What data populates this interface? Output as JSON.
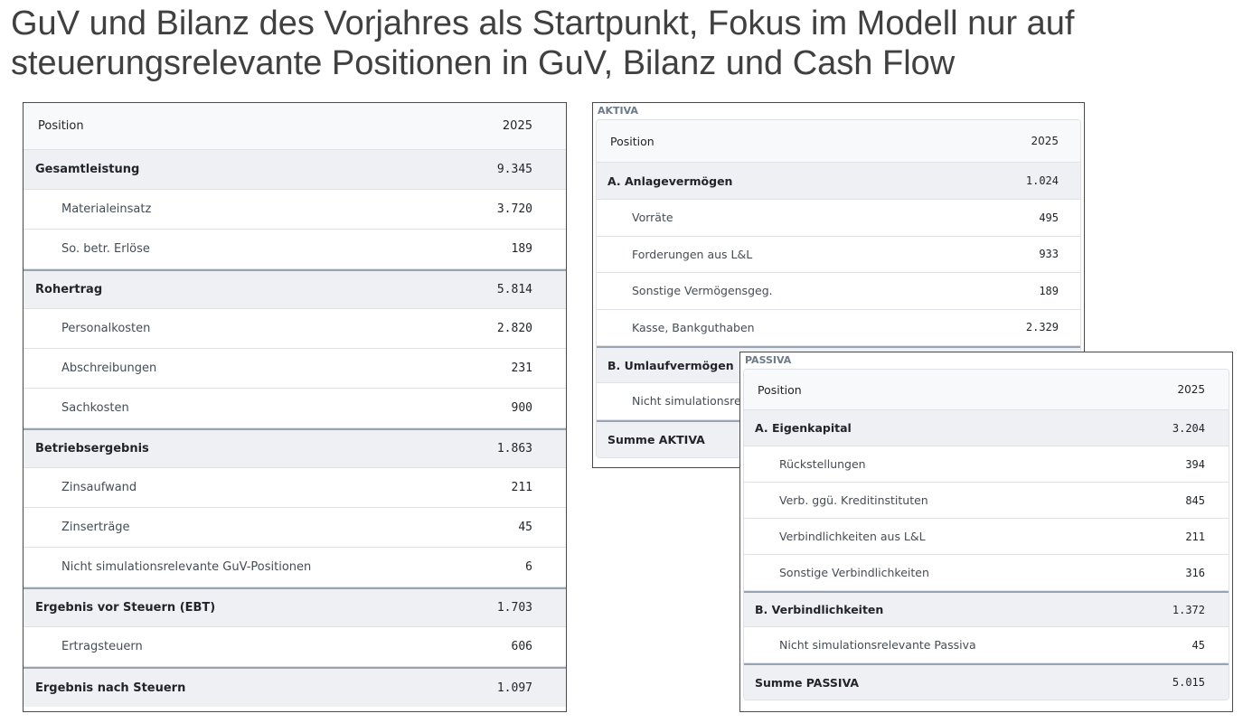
{
  "headline": {
    "line1": "GuV und Bilanz des Vorjahres als Startpunkt, Fokus im Modell nur auf",
    "line2": "steuerungsrelevante Positionen in GuV, Bilanz und Cash Flow"
  },
  "guv": {
    "header": {
      "position": "Position",
      "year": "2025"
    },
    "rows": [
      {
        "label": "Gesamtleistung",
        "value": "9.345"
      },
      {
        "label": "Materialeinsatz",
        "value": "3.720"
      },
      {
        "label": "So. betr. Erlöse",
        "value": "189"
      },
      {
        "label": "Rohertrag",
        "value": "5.814"
      },
      {
        "label": "Personalkosten",
        "value": "2.820"
      },
      {
        "label": "Abschreibungen",
        "value": "231"
      },
      {
        "label": "Sachkosten",
        "value": "900"
      },
      {
        "label": "Betriebsergebnis",
        "value": "1.863"
      },
      {
        "label": "Zinsaufwand",
        "value": "211"
      },
      {
        "label": "Zinserträge",
        "value": "45"
      },
      {
        "label": "Nicht simulationsrelevante GuV-Positionen",
        "value": "6"
      },
      {
        "label": "Ergebnis vor Steuern (EBT)",
        "value": "1.703"
      },
      {
        "label": "Ertragsteuern",
        "value": "606"
      },
      {
        "label": "Ergebnis nach Steuern",
        "value": "1.097"
      }
    ]
  },
  "aktiva": {
    "title": "AKTIVA",
    "header": {
      "position": "Position",
      "year": "2025"
    },
    "rows": [
      {
        "label": "A. Anlagevermögen",
        "value": "1.024"
      },
      {
        "label": "Vorräte",
        "value": "495"
      },
      {
        "label": "Forderungen aus L&L",
        "value": "933"
      },
      {
        "label": "Sonstige Vermögensgeg.",
        "value": "189"
      },
      {
        "label": "Kasse, Bankguthaben",
        "value": "2.329"
      },
      {
        "label": "B. Umlaufvermögen",
        "value": ""
      },
      {
        "label": "Nicht simulationsrel",
        "value": ""
      },
      {
        "label": "Summe AKTIVA",
        "value": ""
      }
    ]
  },
  "passiva": {
    "title": "PASSIVA",
    "header": {
      "position": "Position",
      "year": "2025"
    },
    "rows": [
      {
        "label": "A. Eigenkapital",
        "value": "3.204"
      },
      {
        "label": "Rückstellungen",
        "value": "394"
      },
      {
        "label": "Verb. ggü. Kreditinstituten",
        "value": "845"
      },
      {
        "label": "Verbindlichkeiten aus L&L",
        "value": "211"
      },
      {
        "label": "Sonstige Verbindlichkeiten",
        "value": "316"
      },
      {
        "label": "B. Verbindlichkeiten",
        "value": "1.372"
      },
      {
        "label": "Nicht simulationsrelevante Passiva",
        "value": "45"
      },
      {
        "label": "Summe PASSIVA",
        "value": "5.015"
      }
    ]
  }
}
